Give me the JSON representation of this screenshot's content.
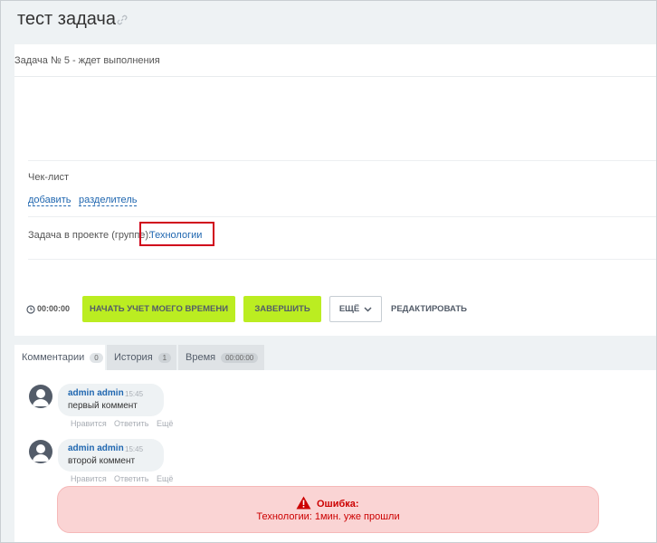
{
  "page": {
    "title": "тест задача"
  },
  "task": {
    "header": "Задача № 5 - ждет выполнения",
    "checklist": {
      "title": "Чек-лист",
      "add_label": "добавить",
      "separator_label": "разделитель"
    },
    "project": {
      "label": "Задача в проекте (группе):",
      "value": "Технологии"
    }
  },
  "toolbar": {
    "timer": "00:00:00",
    "start_label": "НАЧАТЬ УЧЕТ МОЕГО ВРЕМЕНИ",
    "finish_label": "ЗАВЕРШИТЬ",
    "more_label": "ЕЩЁ",
    "edit_label": "РЕДАКТИРОВАТЬ"
  },
  "tabs": [
    {
      "label": "Комментарии",
      "badge": "0"
    },
    {
      "label": "История",
      "badge": "1"
    },
    {
      "label": "Время",
      "badge": "00:00:00"
    }
  ],
  "comments": [
    {
      "author": "admin admin",
      "time": "15:45",
      "text": "первый коммент"
    },
    {
      "author": "admin admin",
      "time": "15:45",
      "text": "второй коммент"
    }
  ],
  "comment_actions": {
    "like": "Нравится",
    "reply": "Ответить",
    "more": "Ещё"
  },
  "error": {
    "title": "Ошибка:",
    "message": "Технологии: 1мин. уже прошли"
  },
  "colors": {
    "accent_green": "#bbed21",
    "link_blue": "#2067b0",
    "error_red": "#cc0000",
    "error_bg": "#fad4d4",
    "highlight_box": "#d0021b"
  }
}
